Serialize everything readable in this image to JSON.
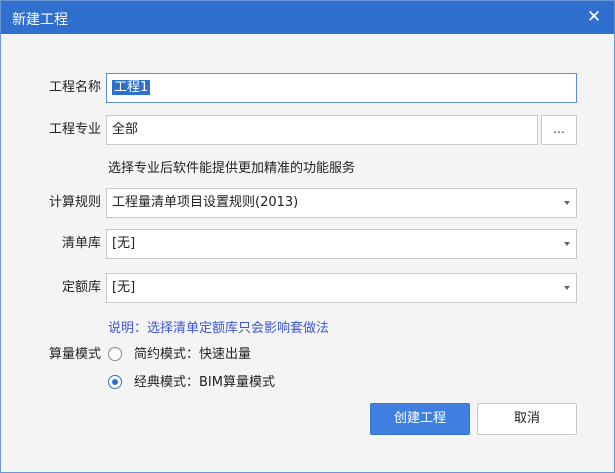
{
  "window": {
    "title": "新建工程",
    "close_glyph": "✕"
  },
  "form": {
    "project_name": {
      "label": "工程名称",
      "value": "工程1"
    },
    "project_major": {
      "label": "工程专业",
      "value": "全部",
      "browse_label": "..."
    },
    "major_hint": "选择专业后软件能提供更加精准的功能服务",
    "calc_rule": {
      "label": "计算规则",
      "value": "工程量清单项目设置规则(2013)"
    },
    "bill_library": {
      "label": "清单库",
      "value": "[无]"
    },
    "quota_library": {
      "label": "定额库",
      "value": "[无]"
    },
    "library_note": "说明：选择清单定额库只会影响套做法",
    "mode": {
      "label": "算量模式",
      "options": [
        {
          "label": "简约模式：快速出量",
          "checked": false
        },
        {
          "label": "经典模式：BIM算量模式",
          "checked": true
        }
      ]
    }
  },
  "buttons": {
    "create_label": "创建工程",
    "cancel_label": "取消"
  },
  "colors": {
    "accent": "#2f6fce",
    "note": "#3c56d6"
  }
}
